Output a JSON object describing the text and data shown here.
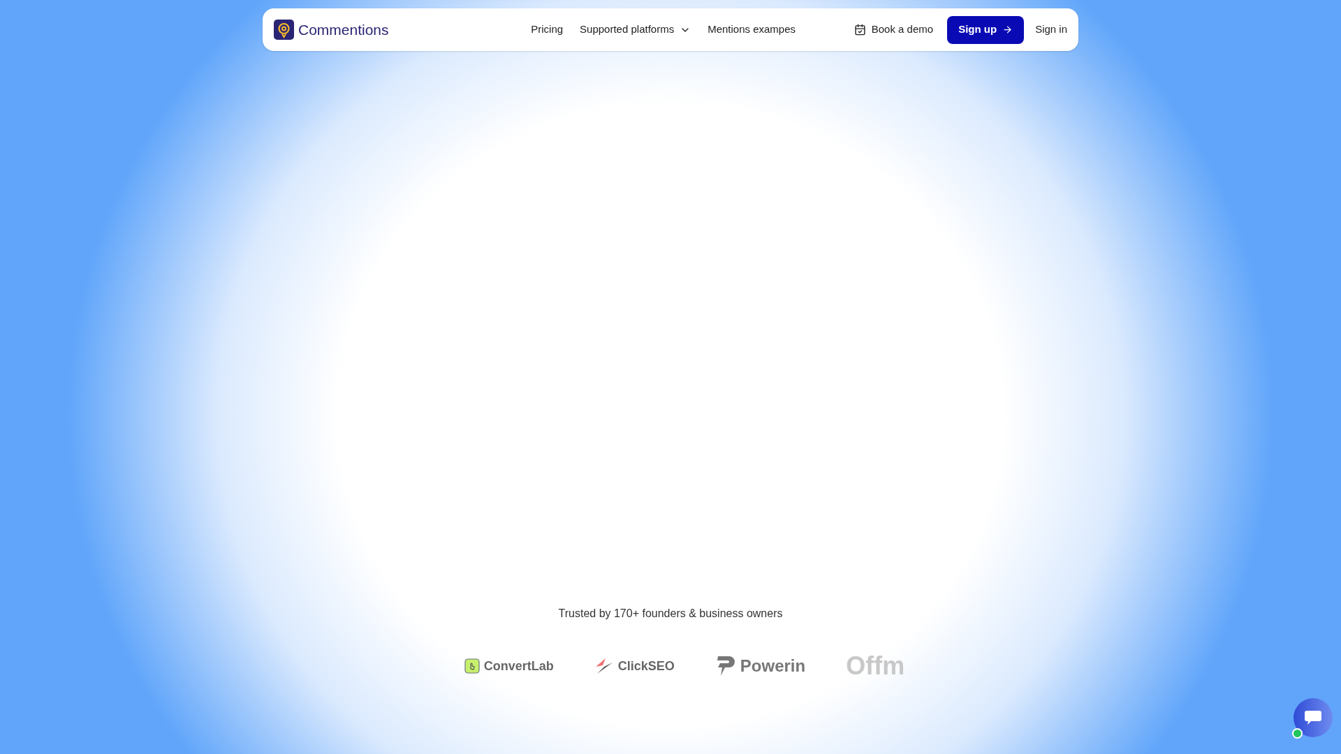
{
  "nav": {
    "brand": "Commentions",
    "links": [
      {
        "label": "Pricing",
        "kind": "link"
      },
      {
        "label": "Supported platforms",
        "kind": "dropdown"
      },
      {
        "label": "Mentions exampes",
        "kind": "link"
      }
    ],
    "demo": "Book a demo",
    "signup": "Sign up",
    "signin": "Sign in"
  },
  "trusted": {
    "text": "Trusted by 170+ founders & business owners",
    "logos": [
      {
        "name": "ConvertLab",
        "kind": "convertlab"
      },
      {
        "name": "ClickSEO",
        "kind": "clickseo"
      },
      {
        "name": "Powerin",
        "kind": "powerin"
      },
      {
        "name": "Offm",
        "kind": "faded"
      }
    ]
  },
  "chat": {
    "online": true
  }
}
